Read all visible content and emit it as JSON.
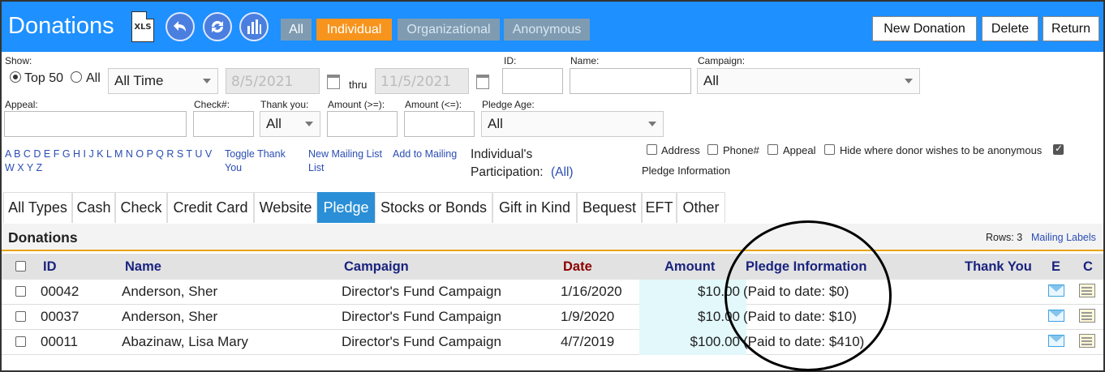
{
  "header": {
    "title": "Donations",
    "xls_label": "XLS",
    "filters": [
      "All",
      "Individual",
      "Organizational",
      "Anonymous"
    ],
    "active_filter": "Individual",
    "actions": [
      "New Donation",
      "Delete",
      "Return"
    ]
  },
  "show": {
    "label": "Show:",
    "option_top": "Top 50",
    "option_all": "All",
    "period": "All Time",
    "date_from": "8/5/2021",
    "thru": "thru",
    "date_to": "11/5/2021"
  },
  "fields": {
    "id_label": "ID:",
    "name_label": "Name:",
    "campaign_label": "Campaign:",
    "campaign_value": "All",
    "appeal_label": "Appeal:",
    "check_label": "Check#:",
    "thankyou_label": "Thank you:",
    "thankyou_value": "All",
    "amount_ge_label": "Amount (>=):",
    "amount_le_label": "Amount (<=):",
    "pledge_age_label": "Pledge Age:",
    "pledge_age_value": "All"
  },
  "links": {
    "alpha_line1": "A B C D E F G H I J K L M N O P Q R S T U V",
    "alpha_line2": "W X Y Z",
    "toggle_thank_1": "Toggle Thank",
    "toggle_thank_2": "You",
    "new_mailing_1": "New Mailing List",
    "new_mailing_2": "List",
    "add_mailing": "Add to Mailing"
  },
  "participation": {
    "line1": "Individual's",
    "line2": "Participation:",
    "value": "(All)"
  },
  "options": {
    "address": "Address",
    "phone": "Phone#",
    "appeal": "Appeal",
    "hide_anon": "Hide where donor wishes to be anonymous",
    "pledge_info": "Pledge Information"
  },
  "tabs": [
    "All Types",
    "Cash",
    "Check",
    "Credit Card",
    "Website",
    "Pledge",
    "Stocks or Bonds",
    "Gift in Kind",
    "Bequest",
    "EFT",
    "Other"
  ],
  "active_tab": "Pledge",
  "section": {
    "title": "Donations",
    "rows_label": "Rows: 3",
    "mailing_labels": "Mailing Labels"
  },
  "table": {
    "columns": [
      "ID",
      "Name",
      "Campaign",
      "Date",
      "Amount",
      "Pledge Information",
      "Thank You",
      "E",
      "C"
    ],
    "rows": [
      {
        "id": "00042",
        "name": "Anderson, Sher",
        "campaign": "Director's Fund Campaign",
        "date": "1/16/2020",
        "amount": "$10.00",
        "pledge": "(Paid to date: $0)"
      },
      {
        "id": "00037",
        "name": "Anderson, Sher",
        "campaign": "Director's Fund Campaign",
        "date": "1/9/2020",
        "amount": "$10.00",
        "pledge": "(Paid to date: $10)"
      },
      {
        "id": "00011",
        "name": "Abazinaw, Lisa Mary",
        "campaign": "Director's Fund Campaign",
        "date": "4/7/2019",
        "amount": "$100.00",
        "pledge": "(Paid to date: $410)"
      }
    ]
  },
  "colors": {
    "header_bg": "#1e90ff",
    "active_filter": "#f7941d",
    "inactive_filter": "#7f9bb1",
    "active_tab": "#2a8fd6",
    "column_header": "#1a237e",
    "date_header": "#8b0000"
  }
}
